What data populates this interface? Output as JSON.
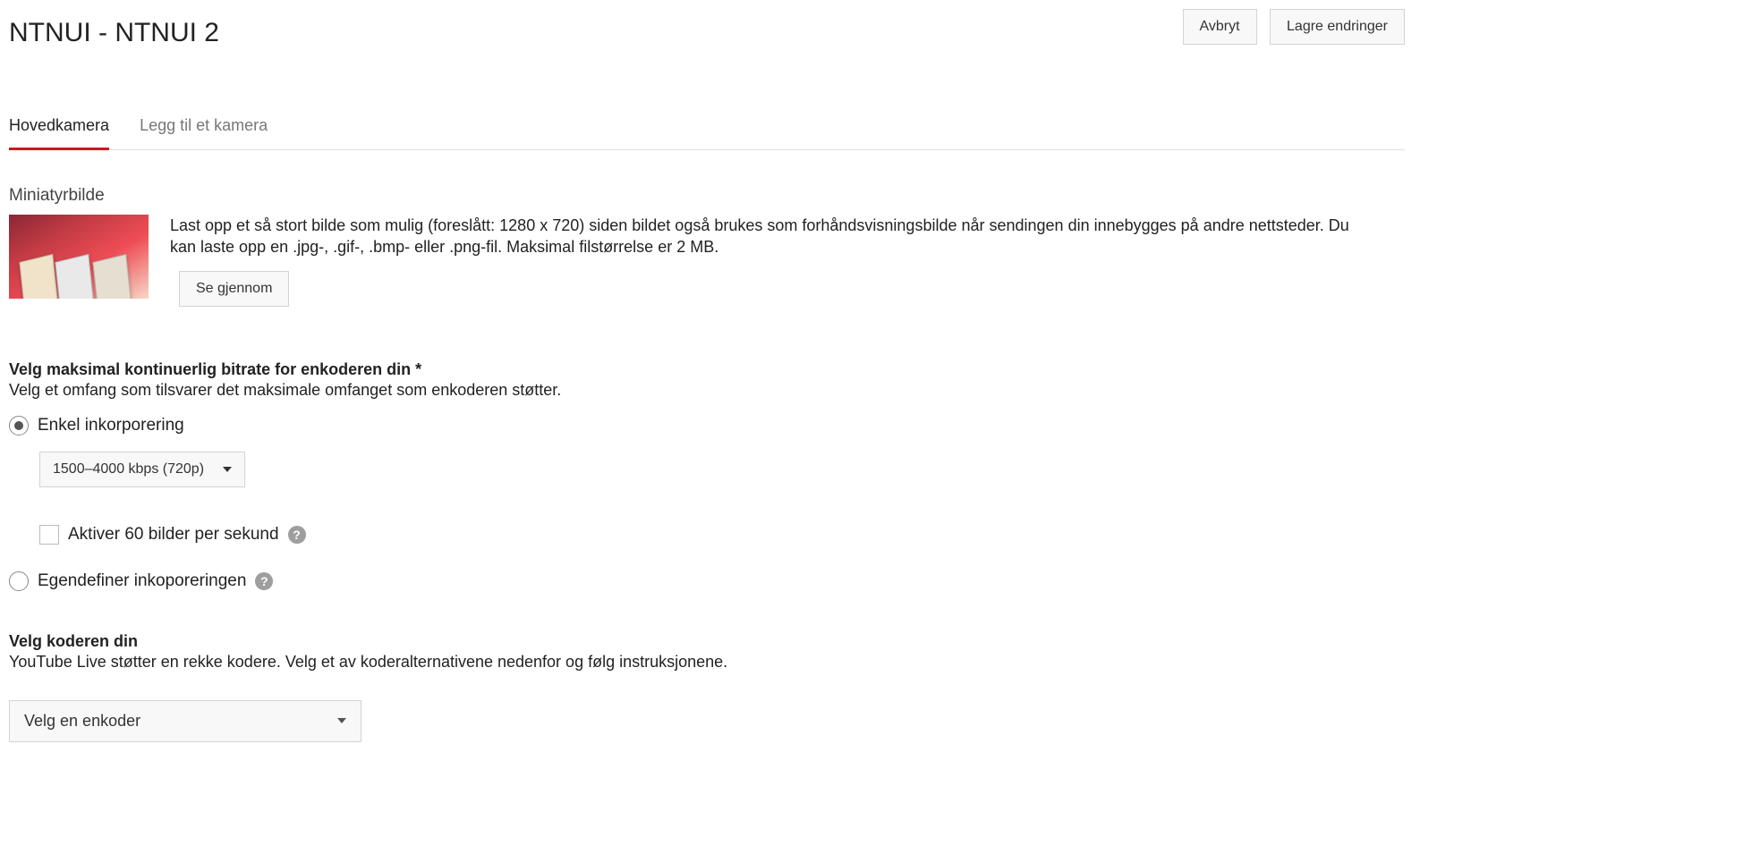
{
  "header": {
    "title": "NTNUI - NTNUI 2",
    "cancel_label": "Avbryt",
    "save_label": "Lagre endringer"
  },
  "tabs": {
    "main": "Hovedkamera",
    "add": "Legg til et kamera"
  },
  "thumbnail": {
    "section_label": "Miniatyrbilde",
    "description": "Last opp et så stort bilde som mulig (foreslått: 1280 x 720) siden bildet også brukes som forhåndsvisningsbilde når sendingen din innebygges på andre nettsteder. Du kan laste opp en .jpg-, .gif-, .bmp- eller .png-fil. Maksimal filstørrelse er 2 MB.",
    "browse_label": "Se gjennom"
  },
  "bitrate": {
    "heading": "Velg maksimal kontinuerlig bitrate for enkoderen din *",
    "subcopy": "Velg et omfang som tilsvarer det maksimale omfanget som enkoderen støtter.",
    "option_simple": "Enkel inkorporering",
    "selected_bitrate": "1500–4000 kbps (720p)",
    "fps_label": "Aktiver 60 bilder per sekund",
    "option_custom": "Egendefiner inkoporeringen"
  },
  "encoder": {
    "heading": "Velg koderen din",
    "subcopy": "YouTube Live støtter en rekke kodere. Velg et av koderalternativene nedenfor og følg instruksjonene.",
    "placeholder": "Velg en enkoder"
  },
  "glyphs": {
    "help": "?"
  }
}
